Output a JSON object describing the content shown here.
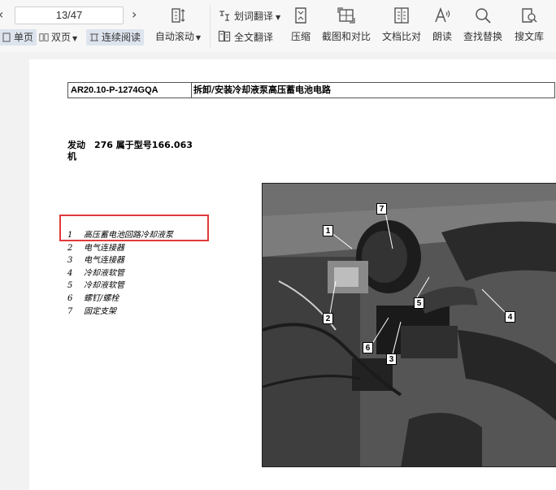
{
  "toolbar": {
    "prev_glyph": "‹",
    "next_glyph": "›",
    "page_indicator": "13/47",
    "single_page": "单页",
    "double_page": "双页",
    "continuous": "连续阅读",
    "auto_scroll": "自动滚动",
    "word_translate": "划词翻译",
    "full_translate": "全文翻译",
    "compress": "压缩",
    "screenshot_compare": "截图和对比",
    "doc_compare": "文档比对",
    "read_aloud": "朗读",
    "find_replace": "查找替换",
    "search_library": "搜文库"
  },
  "document": {
    "doc_id": "AR20.10-P-1274GQA",
    "doc_title": "拆卸/安装冷却液泵高压蓄电池电路",
    "engine_line1": "发动　276 属于型号166.063",
    "engine_line2": "机",
    "legend": [
      {
        "num": "1",
        "text": "高压蓄电池回路冷却液泵"
      },
      {
        "num": "2",
        "text": "电气连接器"
      },
      {
        "num": "3",
        "text": "电气连接器"
      },
      {
        "num": "4",
        "text": "冷却液软管"
      },
      {
        "num": "5",
        "text": "冷却液软管"
      },
      {
        "num": "6",
        "text": "螺钉/螺栓"
      },
      {
        "num": "7",
        "text": "固定支架"
      }
    ],
    "callouts": [
      "1",
      "2",
      "3",
      "4",
      "5",
      "6",
      "7"
    ]
  },
  "colors": {
    "highlight": "#e03a3a",
    "toolbar_bg": "#f7f7f7",
    "active_mode_bg": "#dde4ee"
  }
}
